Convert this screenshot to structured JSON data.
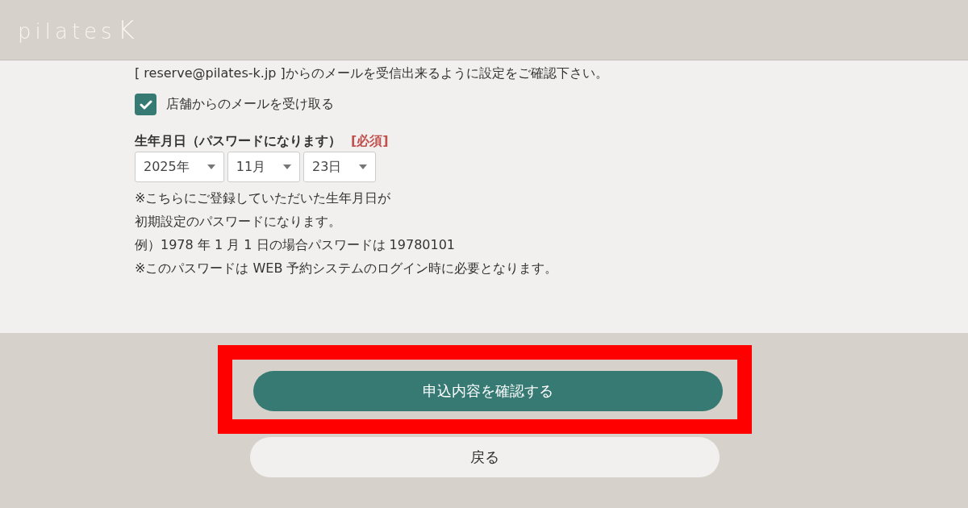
{
  "header": {
    "logo": "pilates",
    "logo_mark": "K"
  },
  "form": {
    "mail_notice": "[ reserve@pilates-k.jp ]からのメールを受信出来るように設定をご確認下さい。",
    "mail_opt_in": {
      "label": "店舗からのメールを受け取る",
      "checked": true
    },
    "birthday": {
      "label": "生年月日（パスワードになります）",
      "required": "[必須]",
      "selects": [
        {
          "value": "2025年"
        },
        {
          "value": "11月"
        },
        {
          "value": "23日"
        }
      ],
      "notes": [
        "※こちらにご登録していただいた生年月日が",
        "初期設定のパスワードになります。",
        "例）1978 年 1 月 1 日の場合パスワードは 19780101",
        "※このパスワードは WEB 予約システムのログイン時に必要となります。"
      ]
    }
  },
  "actions": [
    {
      "kind": "primary",
      "label": "申込内容を確認する",
      "highlighted": true
    },
    {
      "kind": "secondary",
      "label": "戻る",
      "highlighted": false
    }
  ]
}
